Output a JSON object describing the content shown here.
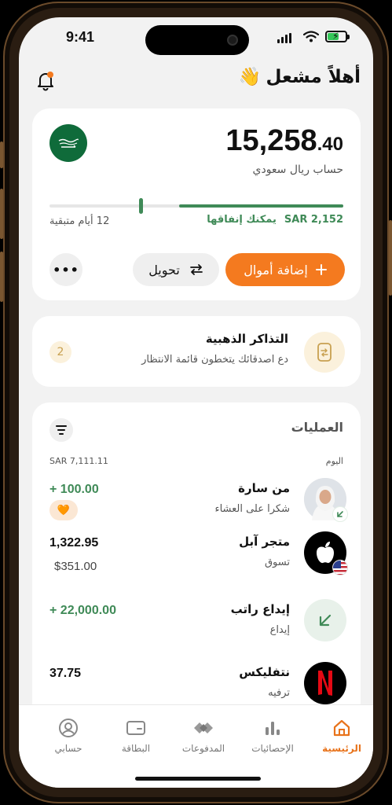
{
  "status": {
    "time": "9:41"
  },
  "header": {
    "greeting": "أهلاً مشعل",
    "wave": "👋"
  },
  "account": {
    "amount_main": "15,258",
    "amount_dec": ".40",
    "name": "حساب ريال سعودي",
    "spendable_label": "يمكنك إنفاقها",
    "spendable_amount": "SAR 2,152",
    "days_left": "12 أيام متبقية",
    "spend_progress": 0.56
  },
  "actions": {
    "add_funds": "إضافة أموال",
    "transfer": "تحويل",
    "more": "•••"
  },
  "golden": {
    "title": "التذاكر الذهبية",
    "subtitle": "دع اصدقائك يتخطون قائمة الانتظار",
    "count": "2"
  },
  "transactions": {
    "title": "العمليات",
    "day_label": "اليوم",
    "day_total": "SAR 7,111.11",
    "items": [
      {
        "name": "من سارة",
        "category": "شكرا على العشاء",
        "amount": "+ 100.00",
        "reaction": "🧡"
      },
      {
        "name": "متجر آبل",
        "category": "تسوق",
        "amount": "1,322.95",
        "sub_amount": "$351.00"
      },
      {
        "name": "إيداع راتب",
        "category": "إيداع",
        "amount": "+ 22,000.00"
      },
      {
        "name": "نتفليكس",
        "category": "ترفيه",
        "amount": "37.75"
      }
    ]
  },
  "tabs": [
    {
      "label": "الرئيسية",
      "icon": "home-icon"
    },
    {
      "label": "الإحصائيات",
      "icon": "stats-icon"
    },
    {
      "label": "المدفوعات",
      "icon": "payments-icon"
    },
    {
      "label": "البطاقة",
      "icon": "card-icon"
    },
    {
      "label": "حسابي",
      "icon": "profile-icon"
    }
  ],
  "colors": {
    "accent": "#f47a1f",
    "green": "#3f8a57",
    "flag": "#0f6b3a"
  }
}
